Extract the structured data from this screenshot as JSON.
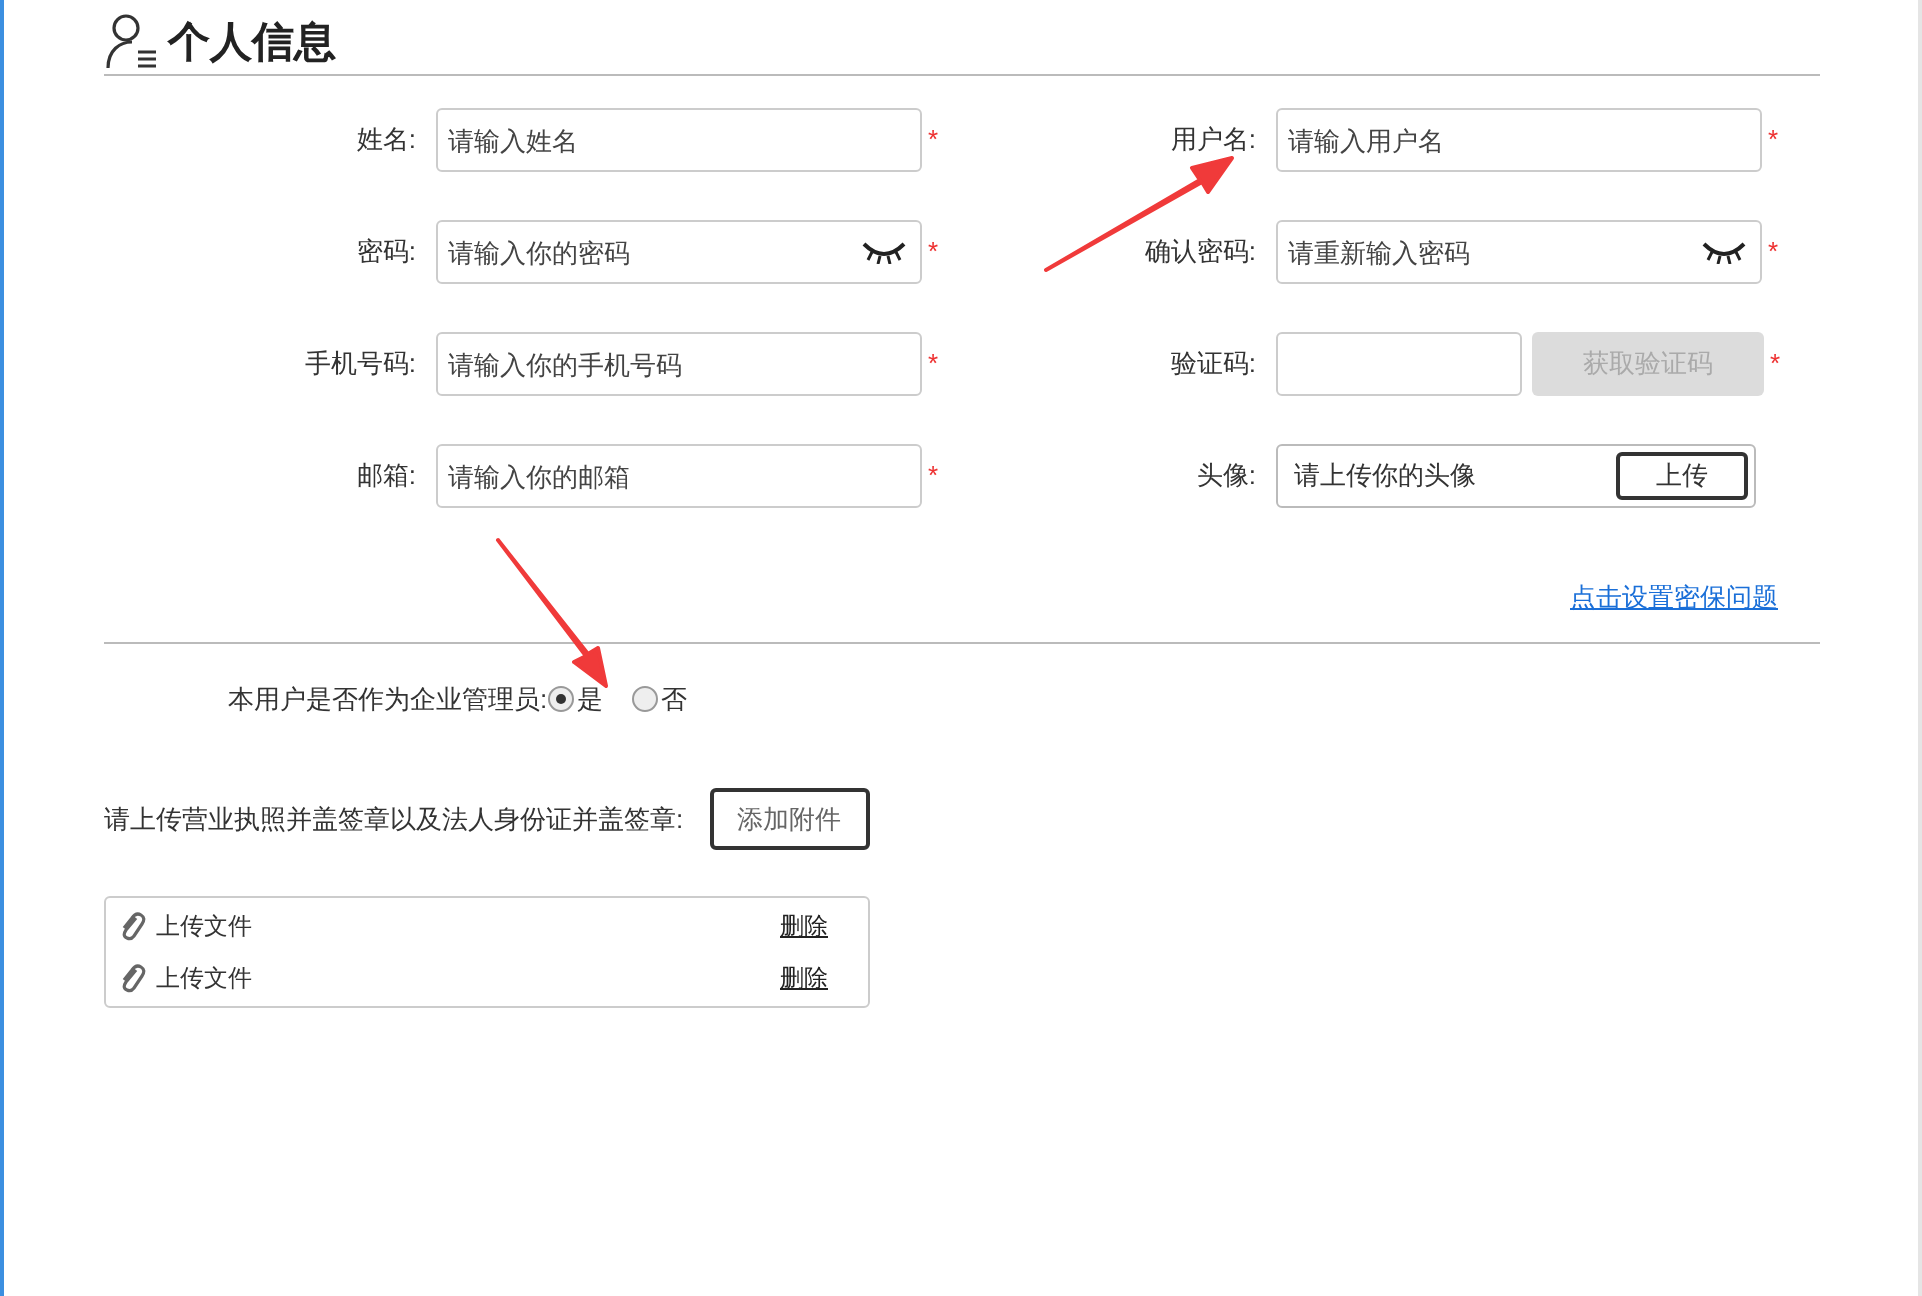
{
  "header": {
    "title": "个人信息"
  },
  "fields": [
    {
      "kind": "text",
      "label": "姓名:",
      "placeholder": "请输入姓名",
      "required_mark": "*"
    },
    {
      "kind": "text",
      "label": "用户名:",
      "placeholder": "请输入用户名",
      "required_mark": "*"
    },
    {
      "kind": "password",
      "label": "密码:",
      "placeholder": "请输入你的密码",
      "required_mark": "*"
    },
    {
      "kind": "password",
      "label": "确认密码:",
      "placeholder": "请重新输入密码",
      "required_mark": "*"
    },
    {
      "kind": "text",
      "label": "手机号码:",
      "placeholder": "请输入你的手机号码",
      "required_mark": "*"
    },
    {
      "kind": "captcha",
      "label": "验证码:",
      "button": "获取验证码",
      "disabled": true,
      "required_mark": "*"
    },
    {
      "kind": "text",
      "label": "邮箱:",
      "placeholder": "请输入你的邮箱",
      "required_mark": "*"
    },
    {
      "kind": "upload",
      "label": "头像:",
      "hint": "请上传你的头像",
      "button": "上传"
    }
  ],
  "security_link": "点击设置密保问题",
  "admin_question": {
    "label": "本用户是否作为企业管理员:",
    "options": [
      {
        "label": "是",
        "selected": true
      },
      {
        "label": "否",
        "selected": false
      }
    ]
  },
  "attachments": {
    "label": "请上传营业执照并盖签章以及法人身份证并盖签章:",
    "button": "添加附件",
    "files": [
      {
        "name": "上传文件",
        "action": "删除"
      },
      {
        "name": "上传文件",
        "action": "删除"
      }
    ]
  }
}
